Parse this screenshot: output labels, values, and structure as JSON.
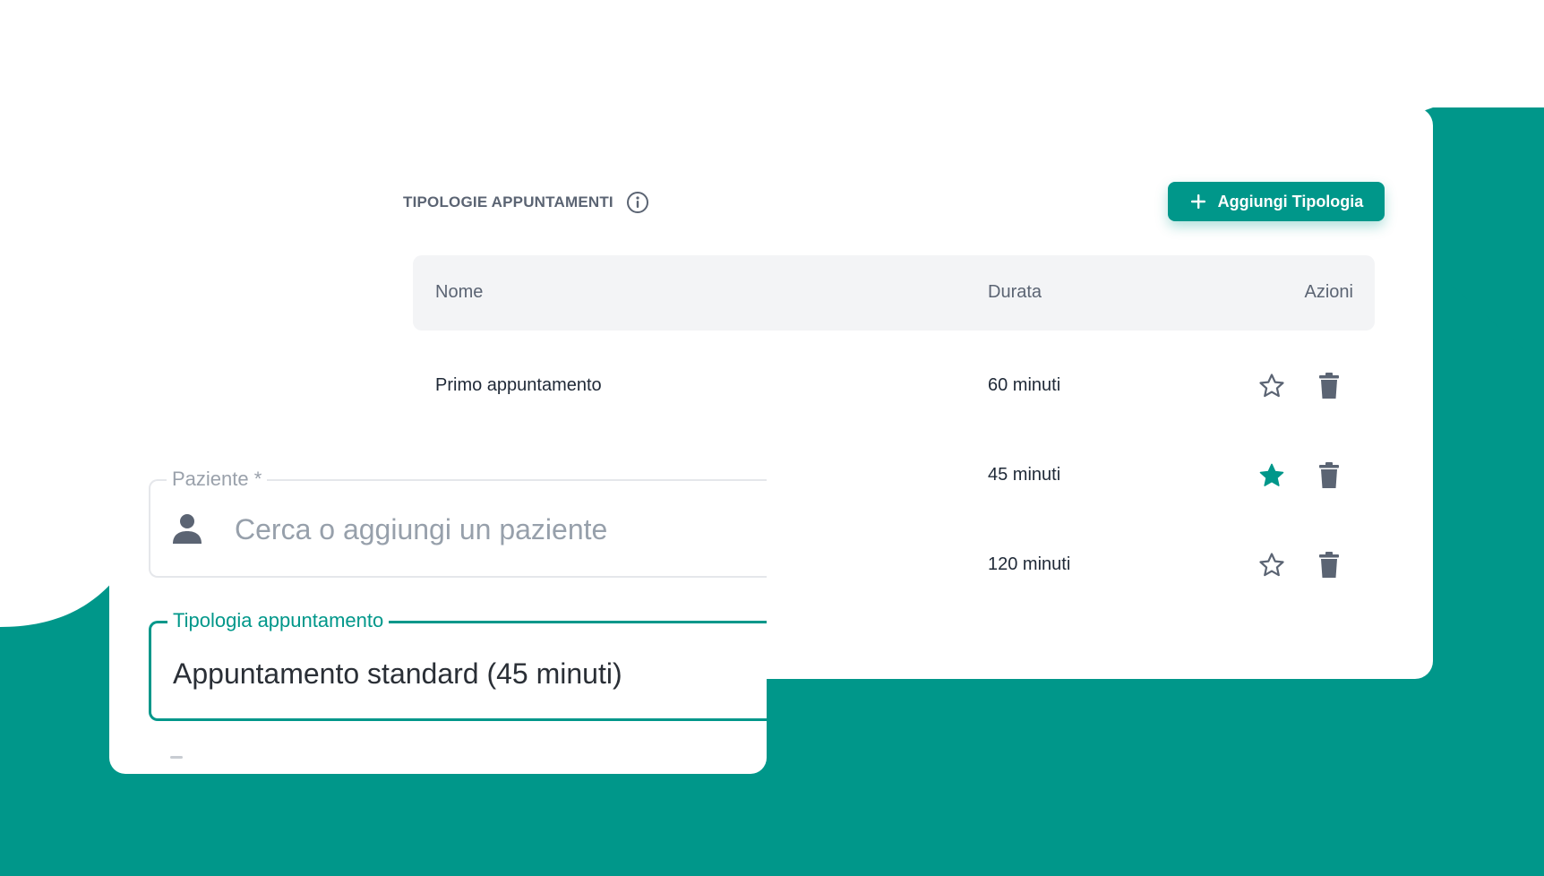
{
  "types_section": {
    "title": "TIPOLOGIE APPUNTAMENTI",
    "add_button_label": "Aggiungi Tipologia",
    "columns": {
      "name": "Nome",
      "duration": "Durata",
      "actions": "Azioni"
    },
    "rows": [
      {
        "name": "Primo appuntamento",
        "duration": "60 minuti",
        "favorite": false
      },
      {
        "name": "",
        "duration": "45 minuti",
        "favorite": true
      },
      {
        "name": "",
        "duration": "120 minuti",
        "favorite": false
      }
    ]
  },
  "form": {
    "patient_label": "Paziente *",
    "patient_placeholder": "Cerca o aggiungi un paziente",
    "type_label": "Tipologia appuntamento",
    "type_value": "Appuntamento standard (45 minuti)"
  },
  "colors": {
    "brand_teal": "#00978a",
    "muted_text": "#5b6473",
    "icon_gray": "#5b6473"
  },
  "icons": {
    "info": "info-icon",
    "add": "plus-icon",
    "favorite": "star-icon",
    "delete": "trash-icon",
    "patient": "person-icon"
  }
}
